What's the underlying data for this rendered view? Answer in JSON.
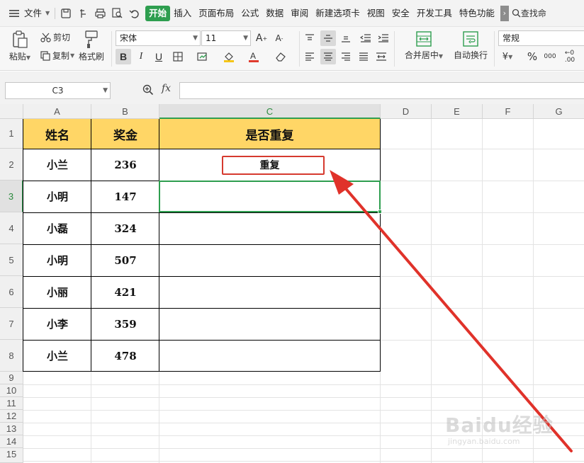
{
  "menu": {
    "file": "文件",
    "tabs": [
      "开始",
      "插入",
      "页面布局",
      "公式",
      "数据",
      "审阅",
      "新建选项卡",
      "视图",
      "安全",
      "开发工具",
      "特色功能"
    ],
    "active_tab": "开始",
    "search": "查找命"
  },
  "ribbon": {
    "paste": "粘贴",
    "cut": "剪切",
    "copy": "复制",
    "format_painter": "格式刷",
    "font_name": "宋体",
    "font_size": "11",
    "bold": "B",
    "italic": "I",
    "underline": "U",
    "merge_center": "合并居中",
    "wrap_text": "自动换行",
    "number_format": "常规"
  },
  "formula_bar": {
    "name_box": "C3",
    "fx": "fx",
    "value": ""
  },
  "sheet": {
    "columns": [
      "A",
      "B",
      "C",
      "D",
      "E",
      "F",
      "G"
    ],
    "selected_column": "C",
    "rows": [
      "1",
      "2",
      "3",
      "4",
      "5",
      "6",
      "7",
      "8",
      "9",
      "10",
      "11",
      "12",
      "13",
      "14",
      "15"
    ],
    "selected_row": "3",
    "headers": [
      "姓名",
      "奖金",
      "是否重复"
    ],
    "data": [
      {
        "name": "小兰",
        "bonus": "236",
        "dup": "重复"
      },
      {
        "name": "小明",
        "bonus": "147",
        "dup": ""
      },
      {
        "name": "小磊",
        "bonus": "324",
        "dup": ""
      },
      {
        "name": "小明",
        "bonus": "507",
        "dup": ""
      },
      {
        "name": "小丽",
        "bonus": "421",
        "dup": ""
      },
      {
        "name": "小李",
        "bonus": "359",
        "dup": ""
      },
      {
        "name": "小兰",
        "bonus": "478",
        "dup": ""
      }
    ]
  },
  "watermark": {
    "brand": "Baidu经验",
    "url": "jingyan.baidu.com"
  },
  "colors": {
    "accent_green": "#2e9e4f",
    "header_fill": "#ffd666",
    "annotation_red": "#d63a2f"
  }
}
